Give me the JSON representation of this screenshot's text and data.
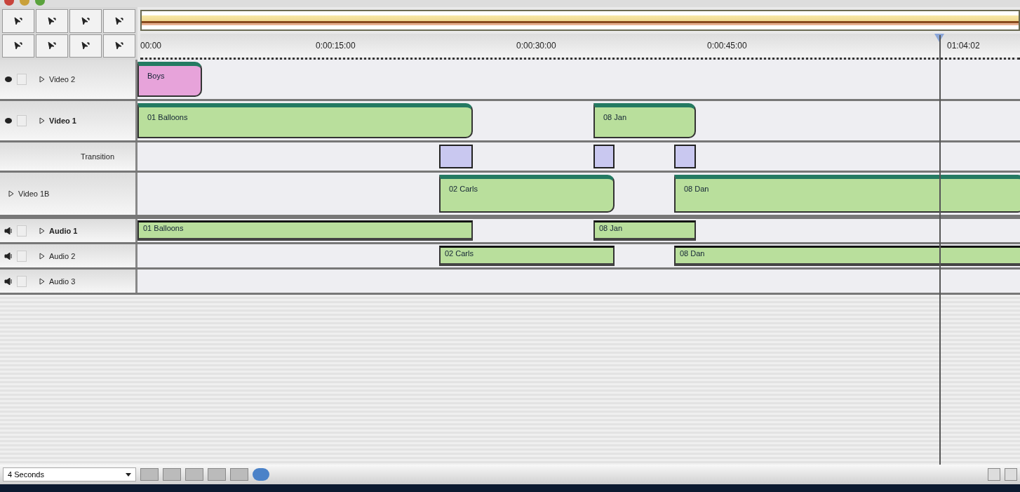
{
  "ruler": {
    "ticks": [
      "00:00",
      "0:00:15:00",
      "0:00:30:00",
      "0:00:45:00",
      "01:04:02"
    ]
  },
  "tracks": [
    {
      "name": "Video 2",
      "kind": "video",
      "locked": false,
      "clips": [
        {
          "label": "Boys",
          "color": "#e7a3da"
        }
      ]
    },
    {
      "name": "Video 1",
      "kind": "video",
      "locked": false,
      "clips": [
        {
          "label": "01 Balloons",
          "color": "#b9df9c"
        },
        {
          "label": "08 Jan",
          "color": "#b9df9c"
        }
      ]
    },
    {
      "name": "Transition",
      "kind": "transition",
      "clips": [
        {
          "color": "#c9c8f0"
        },
        {
          "color": "#c9c8f0"
        },
        {
          "color": "#c9c8f0"
        }
      ]
    },
    {
      "name": "Video 1B",
      "kind": "subvideo",
      "clips": [
        {
          "label": "02 Carls",
          "color": "#b9df9c"
        },
        {
          "label": "08 Dan",
          "color": "#b9df9c"
        }
      ]
    },
    {
      "name": "Audio 1",
      "kind": "audio",
      "locked": false,
      "clips": [
        {
          "label": "01 Balloons",
          "color": "#b9df9c"
        },
        {
          "label": "08 Jan",
          "color": "#b9df9c"
        }
      ]
    },
    {
      "name": "Audio 2",
      "kind": "audio",
      "locked": false,
      "clips": [
        {
          "label": "02 Carls",
          "color": "#b9df9c"
        },
        {
          "label": "08 Dan",
          "color": "#b9df9c"
        }
      ]
    },
    {
      "name": "Audio 3",
      "kind": "audio",
      "locked": false
    }
  ],
  "bottom_bar": {
    "zoom_dropdown": "4 Seconds"
  }
}
